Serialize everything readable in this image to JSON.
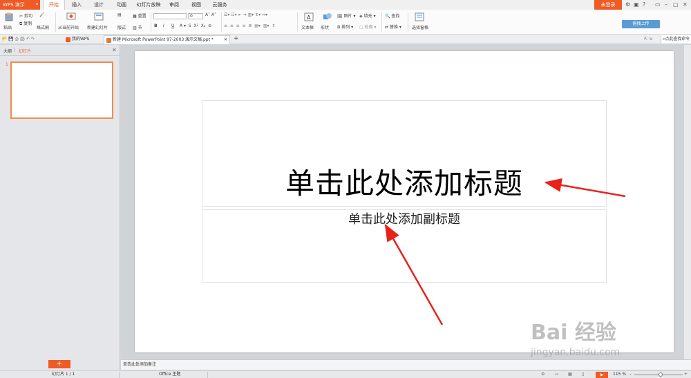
{
  "app": {
    "name": "WPS 演示"
  },
  "menu_tabs": [
    "开始",
    "插入",
    "设计",
    "动画",
    "幻灯片放映",
    "审阅",
    "视图",
    "云服务"
  ],
  "login_label": "未登录",
  "upload_label": "拖拽上传",
  "ribbon": {
    "paste": "粘贴",
    "cut": "剪切",
    "copy": "复制",
    "format_painter": "格式刷",
    "from_current": "从当前开始",
    "new_slide": "新建幻灯片",
    "layout": "版式",
    "reset": "重置",
    "section": "节",
    "font_size": "0",
    "text_box": "文本框",
    "shape": "形状",
    "picture": "图片",
    "arrange": "排列",
    "fill": "填充",
    "outline": "轮廓",
    "find": "查找",
    "replace": "替换",
    "select_pane": "选择窗格",
    "bold": "B",
    "italic": "I",
    "underline": "U"
  },
  "doc_tabs": {
    "my_wps": "我的WPS",
    "current": "新建 Microsoft PowerPoint 97-2003 演示文稿.ppt *",
    "search": "点此查找命令"
  },
  "left_panel": {
    "outline_tab": "大纲",
    "slides_tab": "幻灯片",
    "slide_number": "1",
    "add_button": "+"
  },
  "slide": {
    "title": "单击此处添加标题",
    "subtitle": "单击此处添加副标题"
  },
  "notes_placeholder": "单击此处添加备注",
  "status": {
    "slide_count": "幻灯片 1 / 1",
    "theme": "Office 主题",
    "zoom": "115 %",
    "play": "▶"
  },
  "watermark": {
    "main": "Bai 经验",
    "sub": "jingyan.baidu.com"
  },
  "colors": {
    "accent": "#f05a24",
    "annotation_arrow": "#e8211b"
  },
  "icons": [
    "paste-icon",
    "cut-icon",
    "copy-icon",
    "format-painter-icon",
    "slideshow-icon",
    "new-slide-icon",
    "layout-icon",
    "textbox-icon",
    "shape-icon",
    "picture-icon",
    "find-icon",
    "replace-icon",
    "select-pane-icon",
    "close-icon",
    "plus-icon",
    "play-icon"
  ]
}
